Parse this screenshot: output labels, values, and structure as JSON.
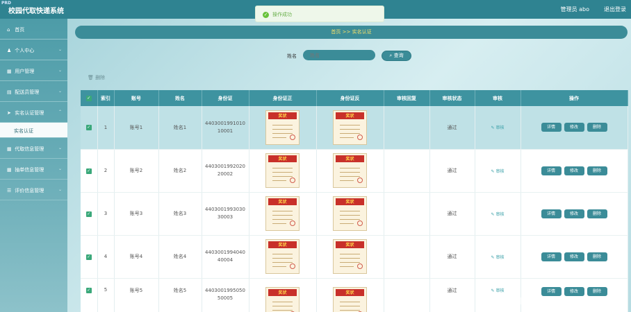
{
  "header": {
    "logo_badge": "PRD",
    "title": "校园代取快递系统",
    "admin": "管理员 abo",
    "logout": "退出登录"
  },
  "toast": {
    "text": "操作成功"
  },
  "sidebar": {
    "items": [
      {
        "label": "首页",
        "icon": "home-icon"
      },
      {
        "label": "个人中心",
        "icon": "user-icon"
      },
      {
        "label": "用户管理",
        "icon": "grid-icon"
      },
      {
        "label": "配送员管理",
        "icon": "grid-icon"
      },
      {
        "label": "实名认证管理",
        "icon": "send-icon"
      }
    ],
    "active_sub": "实名认证",
    "items_after": [
      {
        "label": "代取信息管理",
        "icon": "grid-icon"
      },
      {
        "label": "抽单信息管理",
        "icon": "grid-icon"
      },
      {
        "label": "评价信息管理",
        "icon": "list-icon"
      }
    ]
  },
  "breadcrumb": "首页 >> 实名认证",
  "search": {
    "label": "姓名",
    "placeholder": "姓名",
    "button": "查询"
  },
  "delete_top": "删除",
  "table": {
    "headers": [
      "",
      "索引",
      "账号",
      "姓名",
      "身份证",
      "身份证正",
      "身份证反",
      "审核回复",
      "审核状态",
      "审核",
      "操作"
    ],
    "rows": [
      {
        "index": "1",
        "account": "账号1",
        "name": "姓名1",
        "id_line1": "4403001991010",
        "id_line2": "10001",
        "reply": "",
        "status": "通过",
        "audit": "审核"
      },
      {
        "index": "2",
        "account": "账号2",
        "name": "姓名2",
        "id_line1": "4403001992020",
        "id_line2": "20002",
        "reply": "",
        "status": "通过",
        "audit": "审核"
      },
      {
        "index": "3",
        "account": "账号3",
        "name": "姓名3",
        "id_line1": "4403001993030",
        "id_line2": "30003",
        "reply": "",
        "status": "通过",
        "audit": "审核"
      },
      {
        "index": "4",
        "account": "账号4",
        "name": "姓名4",
        "id_line1": "4403001994040",
        "id_line2": "40004",
        "reply": "",
        "status": "通过",
        "audit": "审核"
      },
      {
        "index": "5",
        "account": "账号5",
        "name": "姓名5",
        "id_line1": "4403001995050",
        "id_line2": "50005",
        "reply": "",
        "status": "通过",
        "audit": "审核"
      }
    ],
    "actions": {
      "detail": "详情",
      "edit": "修改",
      "delete": "删除"
    },
    "cert_title": "奖状"
  },
  "watermark": "CSDN @真纯Django毕设程序",
  "colors": {
    "header": "#2f8391",
    "accent": "#3b8c98",
    "checkbox": "#3aa87a"
  }
}
